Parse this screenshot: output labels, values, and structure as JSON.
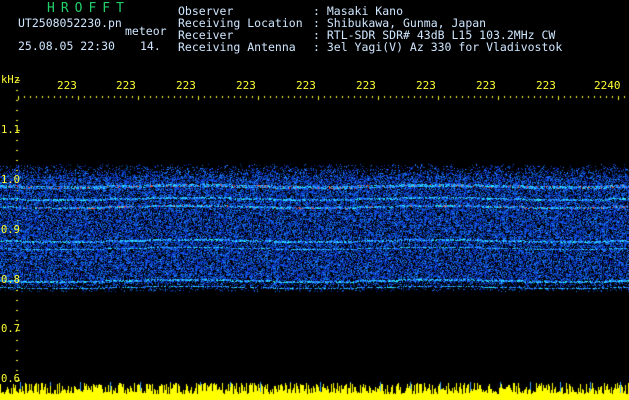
{
  "header": {
    "app_title": "HROFFT",
    "filename": "UT2508052230.pn",
    "mode": "meteor",
    "date_time": "25.08.05 22:30",
    "counter": "14.",
    "fields": [
      {
        "label": "Observer",
        "value": ": Masaki Kano"
      },
      {
        "label": "Receiving Location",
        "value": ": Shibukawa, Gunma, Japan"
      },
      {
        "label": "Receiver",
        "value": ": RTL-SDR SDR# 43dB L15 103.2MHz CW"
      },
      {
        "label": "Receiving Antenna",
        "value": ": 3el Yagi(V) Az 330 for Vladivostok"
      }
    ]
  },
  "time_axis": {
    "ticks": [
      "223",
      "223",
      "223",
      "223",
      "223",
      "223",
      "223",
      "223",
      "223",
      "2240"
    ]
  },
  "freq_axis": {
    "unit": "kHz",
    "ticks": [
      "1.1",
      "1.0",
      "0.9",
      "0.8",
      "0.7",
      "0.6"
    ]
  },
  "colors": {
    "background": "#000000",
    "noise_low": "#0a1f8c",
    "noise_mid": "#1e5cff",
    "signal": "#2cd6ff",
    "hot": "#ff2a2a",
    "amplitude": "#ffff00",
    "marker": "#3aa0ff"
  }
}
